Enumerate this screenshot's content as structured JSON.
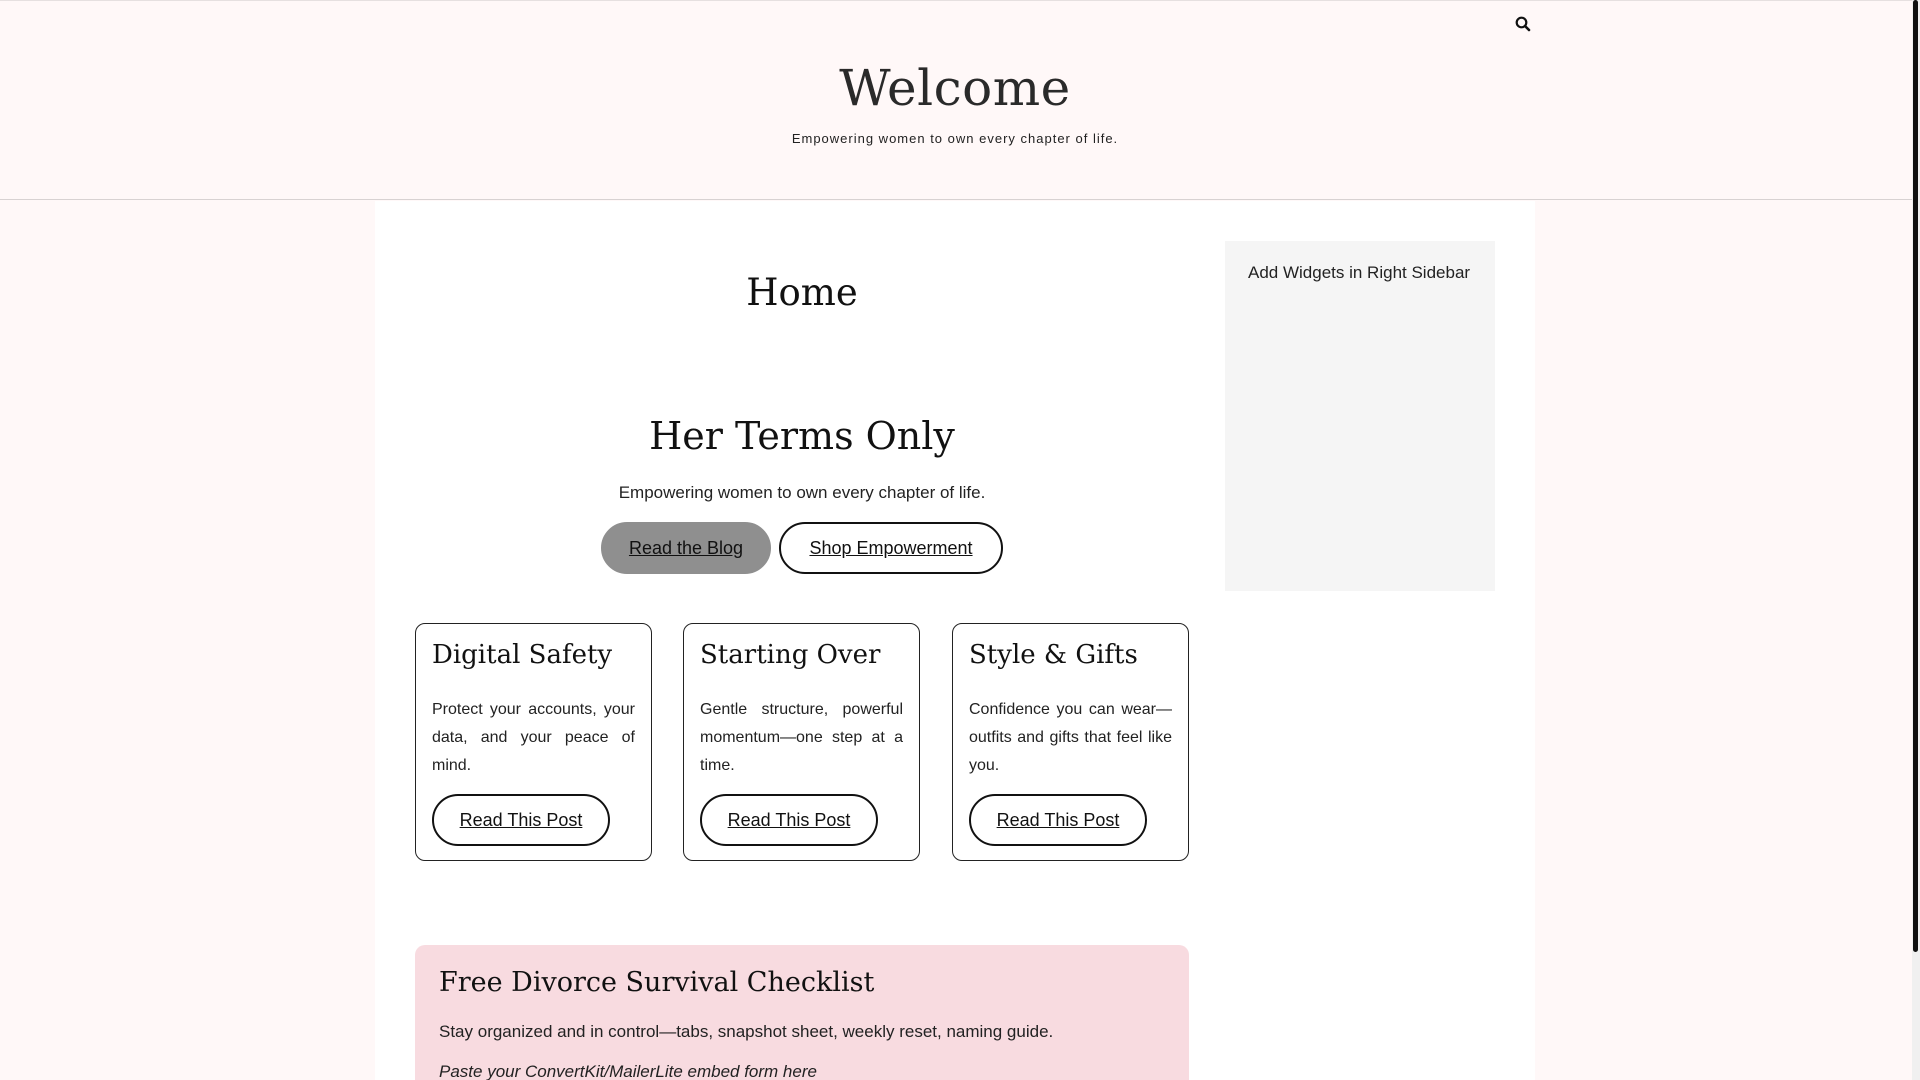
{
  "header": {
    "site_title": "Welcome",
    "tagline": "Empowering women to own every chapter of life.",
    "search_icon": "search-icon"
  },
  "page": {
    "title": "Home"
  },
  "hero": {
    "title": "Her Terms Only",
    "tagline": "Empowering women to own every chapter of life.",
    "primary_button": "Read the Blog",
    "secondary_button": "Shop Empowerment"
  },
  "cards": [
    {
      "title": "Digital Safety",
      "text": "Protect your accounts, your data, and your peace of mind.",
      "button": "Read This Post"
    },
    {
      "title": "Starting Over",
      "text": "Gentle structure, powerful momentum—one step at a time.",
      "button": "Read This Post"
    },
    {
      "title": "Style & Gifts",
      "text": "Confidence you can wear—outfits and gifts that feel like you.",
      "button": "Read This Post"
    }
  ],
  "sidebar": {
    "widget_text": "Add Widgets in Right Sidebar"
  },
  "checklist": {
    "title": "Free Divorce Survival Checklist",
    "text": "Stay organized and in control—tabs, snapshot sheet, weekly reset, naming guide.",
    "embed_placeholder": "Paste your ConvertKit/MailerLite embed form here"
  },
  "colors": {
    "header_bg": "#fff8f8",
    "primary_button_bg": "#8f8f8f",
    "checklist_bg": "#f8dbe0",
    "sidebar_bg": "#f5f5f5"
  }
}
